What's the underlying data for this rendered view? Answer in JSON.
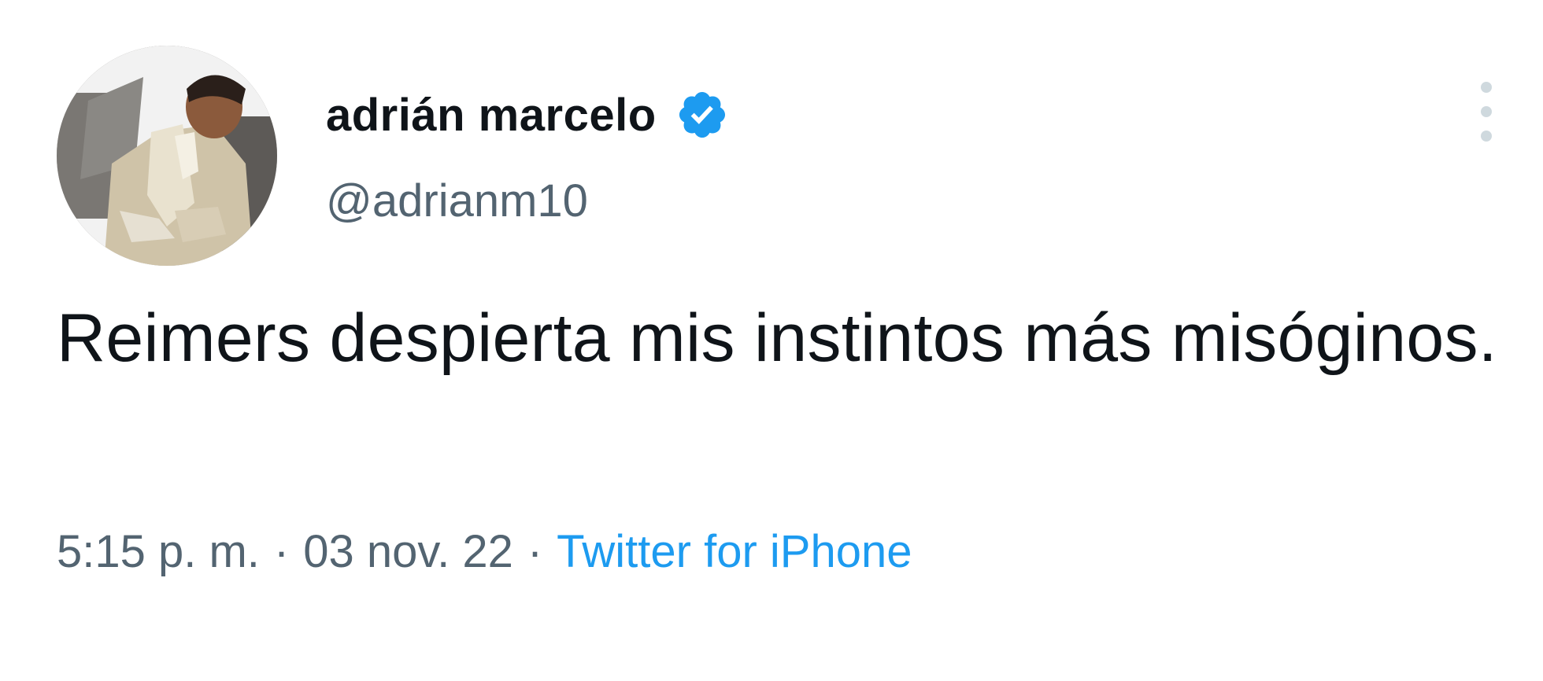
{
  "tweet": {
    "author": {
      "display_name": "adrián marcelo",
      "handle": "@adrianm10",
      "verified": true
    },
    "text": "Reimers despierta mis instintos más misóginos.",
    "time": "5:15 p. m.",
    "separator": "·",
    "date": "03 nov. 22",
    "source": "Twitter for iPhone"
  },
  "icons": {
    "verified": "verified-badge-icon",
    "more": "more-options-icon"
  },
  "colors": {
    "accent": "#1d9bf0",
    "secondary_text": "#536471",
    "primary_text": "#0f1419"
  }
}
